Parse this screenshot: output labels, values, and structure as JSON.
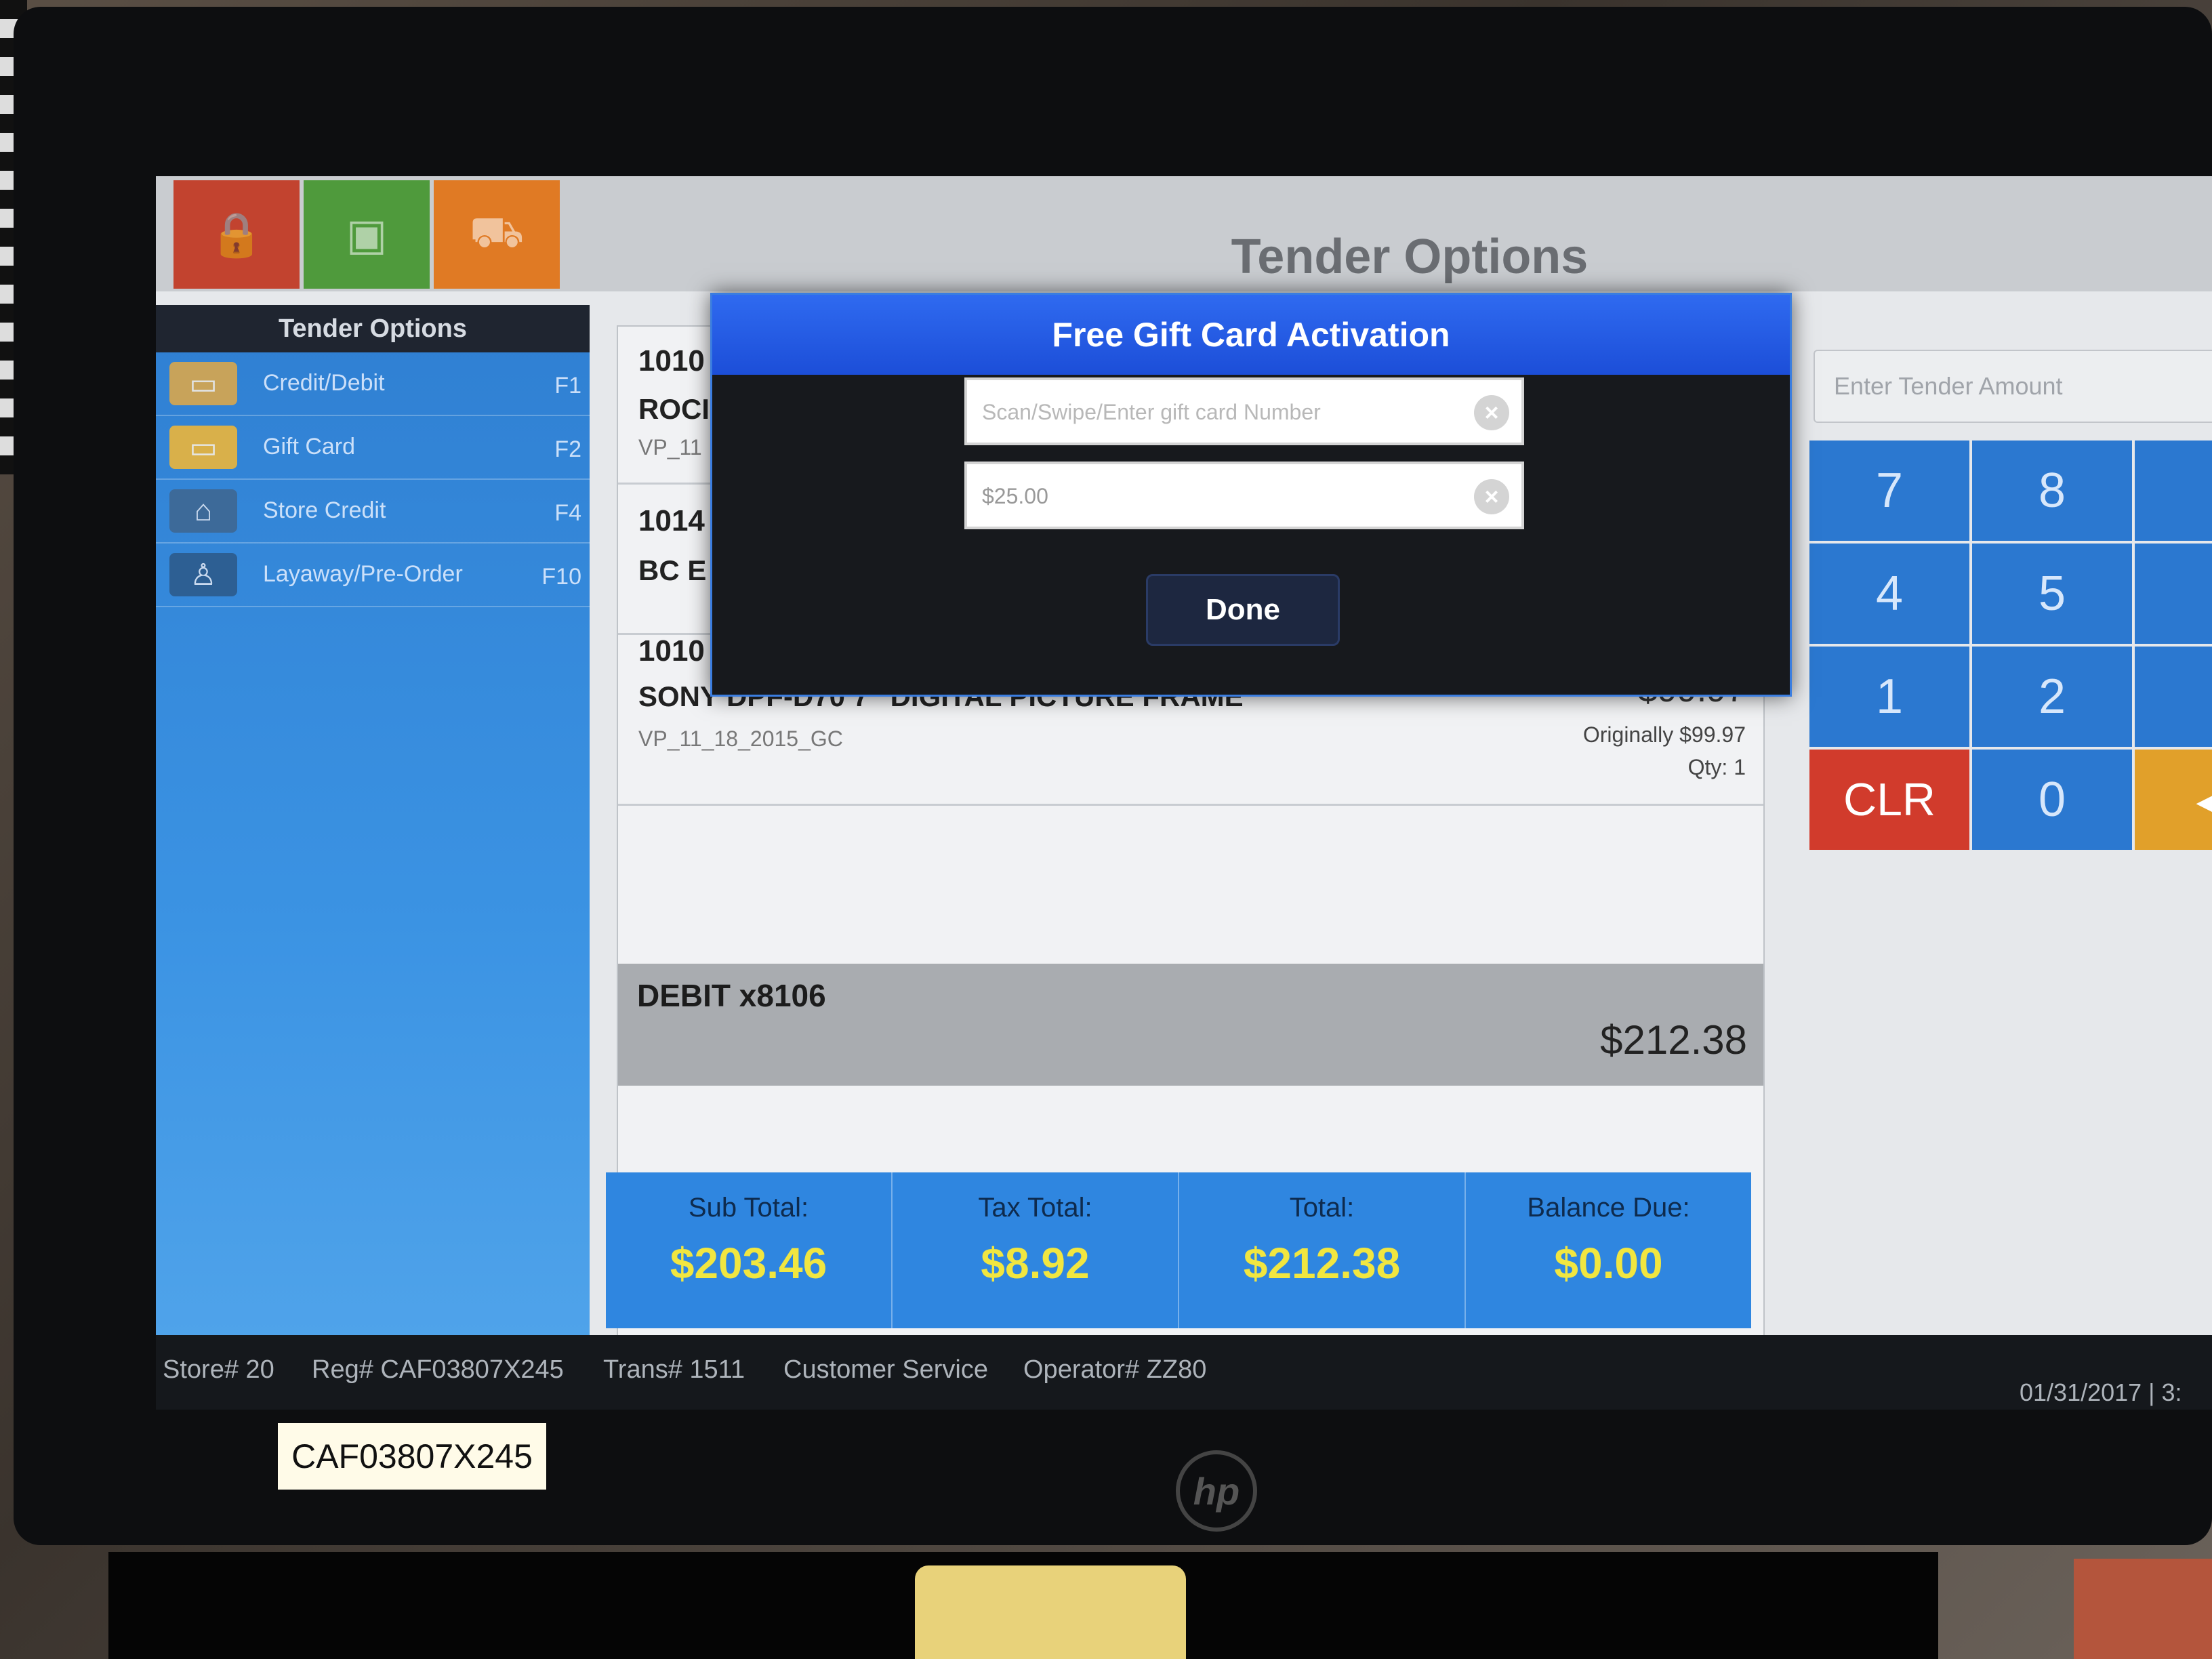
{
  "pos": {
    "header_title": "Tender Options",
    "tiles": [
      {
        "icon": "lock-icon",
        "glyph": "🔒"
      },
      {
        "icon": "customer-display-icon",
        "glyph": "▣"
      },
      {
        "icon": "cart-icon",
        "glyph": "⛟"
      }
    ]
  },
  "sidebar": {
    "title": "Tender Options",
    "items": [
      {
        "label": "Credit/Debit",
        "key": "F1",
        "icon": "credit-card-icon",
        "glyph": "▭"
      },
      {
        "label": "Gift Card",
        "key": "F2",
        "icon": "gift-card-icon",
        "glyph": "▭"
      },
      {
        "label": "Store Credit",
        "key": "F4",
        "icon": "store-credit-icon",
        "glyph": "⌂"
      },
      {
        "label": "Layaway/Pre-Order",
        "key": "F10",
        "icon": "layaway-icon",
        "glyph": "♙"
      }
    ]
  },
  "items": [
    {
      "code": "1010",
      "desc": "ROCI",
      "sub": "VP_11",
      "price": "",
      "orig": "",
      "qty": ""
    },
    {
      "code": "1014",
      "desc": "BC E",
      "sub": "",
      "price": "",
      "orig": "",
      "qty": ""
    },
    {
      "code": "1010",
      "desc": "SONY DPF-D70 7\" DIGITAL PICTURE FRAME",
      "sub": "VP_11_18_2015_GC",
      "price": "$99.97",
      "orig": "Originally $99.97",
      "qty": "Qty: 1"
    }
  ],
  "payment": {
    "label": "DEBIT x8106",
    "amount": "$212.38"
  },
  "totals": [
    {
      "label": "Sub Total:",
      "value": "$203.46"
    },
    {
      "label": "Tax Total:",
      "value": "$8.92"
    },
    {
      "label": "Total:",
      "value": "$212.38"
    },
    {
      "label": "Balance Due:",
      "value": "$0.00"
    }
  ],
  "tender": {
    "placeholder": "Enter Tender Amount",
    "keys": [
      "7",
      "8",
      "4",
      "5",
      "1",
      "2",
      "CLR",
      "0"
    ]
  },
  "status": {
    "store": "Store# 20",
    "register": "Reg# CAF03807X245",
    "trans": "Trans# 1511",
    "mode": "Customer Service",
    "operator": "Operator# ZZ80",
    "datetime": "01/31/2017 | 3:"
  },
  "modal": {
    "title": "Free Gift Card Activation",
    "card_placeholder": "Scan/Swipe/Enter gift card Number",
    "amount_value": "$25.00",
    "done_label": "Done"
  },
  "hardware": {
    "asset_tag": "CAF03807X245",
    "brand_logo": "hp"
  },
  "colors": {
    "modal_header": "#2f6af0",
    "totals_bg": "#2f86e0",
    "totals_value": "#f1e640",
    "clr_key": "#d13b2c",
    "keypad": "#2b78d0"
  }
}
